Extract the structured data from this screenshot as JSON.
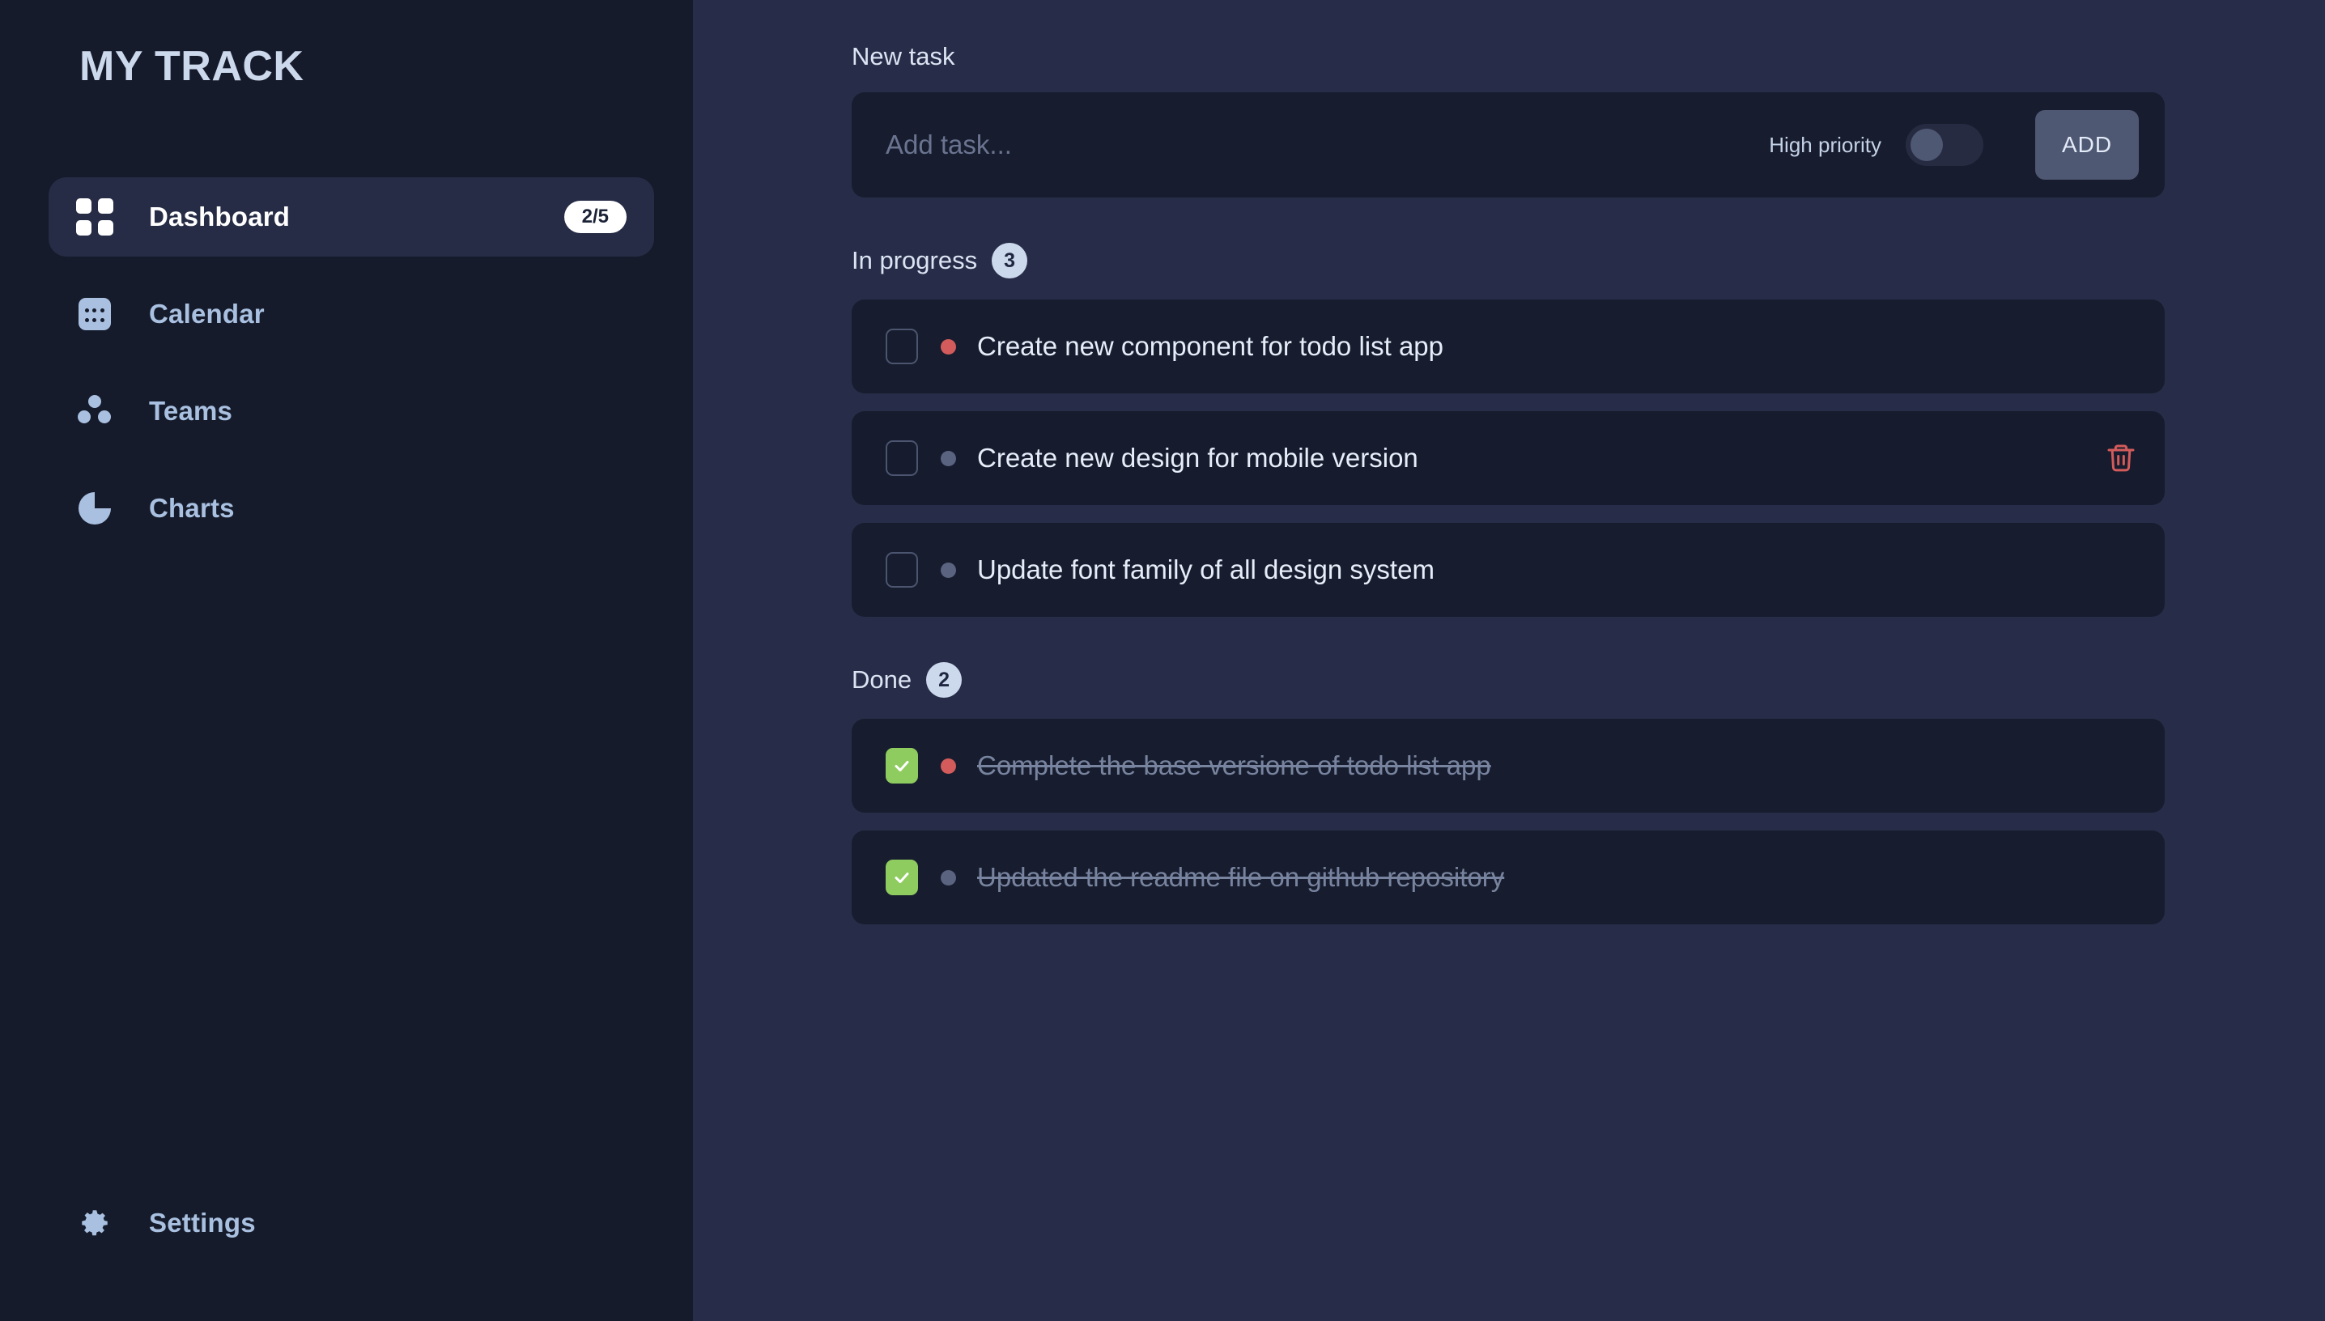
{
  "sidebar": {
    "brand": "MY TRACK",
    "items": [
      {
        "label": "Dashboard",
        "icon": "grid-icon",
        "badge": "2/5",
        "active": true
      },
      {
        "label": "Calendar",
        "icon": "calendar-icon",
        "badge": "",
        "active": false
      },
      {
        "label": "Teams",
        "icon": "teams-icon",
        "badge": "",
        "active": false
      },
      {
        "label": "Charts",
        "icon": "pie-chart-icon",
        "badge": "",
        "active": false
      }
    ],
    "footer": {
      "label": "Settings",
      "icon": "gear-icon"
    }
  },
  "composer": {
    "title": "New task",
    "placeholder": "Add task...",
    "value": "",
    "priority_label": "High priority",
    "priority_on": false,
    "add_label": "ADD"
  },
  "sections": [
    {
      "title": "In progress",
      "count": "3",
      "tasks": [
        {
          "text": "Create new component for todo list app",
          "done": false,
          "priority": "high",
          "hovered": false
        },
        {
          "text": "Create new design for mobile version",
          "done": false,
          "priority": "normal",
          "hovered": true
        },
        {
          "text": "Update font family of all design system",
          "done": false,
          "priority": "normal",
          "hovered": false
        }
      ]
    },
    {
      "title": "Done",
      "count": "2",
      "tasks": [
        {
          "text": "Complete the base versione of todo list app",
          "done": true,
          "priority": "high",
          "hovered": false
        },
        {
          "text": "Updated the readme file on github repository",
          "done": true,
          "priority": "normal",
          "hovered": false
        }
      ]
    }
  ],
  "colors": {
    "sidebar_bg": "#151b2b",
    "main_bg": "#272d48",
    "card_bg": "#171d2e",
    "accent_button": "#4e5873",
    "checkbox_done": "#8fcc5f",
    "priority_high": "#d45b5b",
    "priority_normal": "#5a6380",
    "delete_icon": "#d45b5b",
    "badge_bg": "#ccd8ec"
  }
}
